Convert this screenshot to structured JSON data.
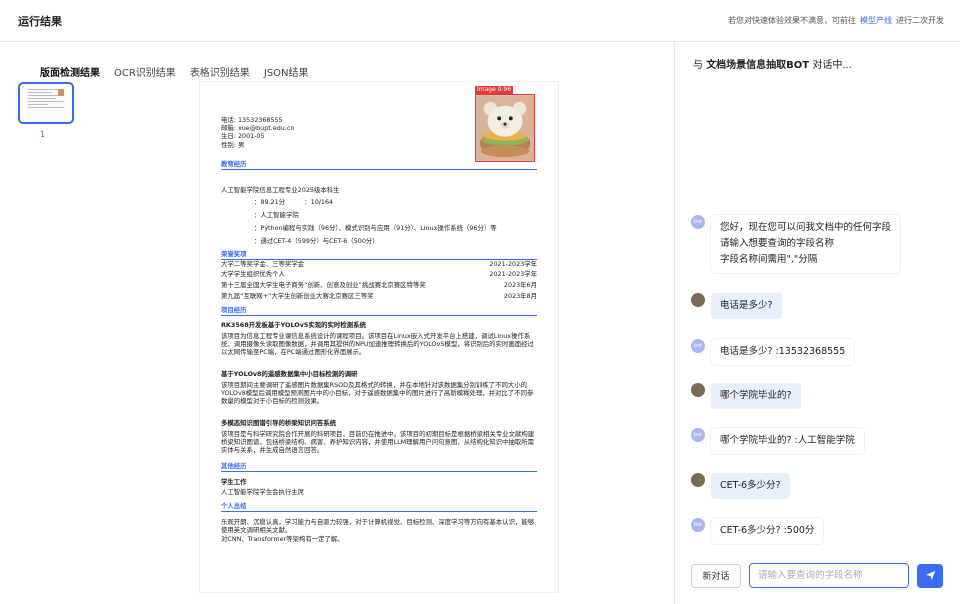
{
  "header": {
    "title": "运行结果",
    "tip_prefix": "若您对快速体验效果不满意，可前往",
    "tip_link": "模型产线",
    "tip_suffix": "进行二次开发"
  },
  "tabs": [
    {
      "label": "版面检测结果"
    },
    {
      "label": "OCR识别结果"
    },
    {
      "label": "表格识别结果"
    },
    {
      "label": "JSON结果"
    }
  ],
  "thumbnail": {
    "page_no": "1"
  },
  "doc": {
    "image_tag": "Image 0.96",
    "contact": [
      "电话: 13532368555",
      "邮箱: xue@bupt.edu.cn",
      "生日: 2001-05",
      "性别: 男"
    ],
    "sec_edu": "教育经历",
    "edu_line": "人工智能学院信息工程专业2025级本科生",
    "edu_details": [
      "：89.21分　　　：10/164",
      "：人工智能学院",
      "：Python编程与实践（96分）、模式识别与应用（91分）、Linux操作系统（96分）等",
      "：通过CET-4（599分）与CET-6（500分）"
    ],
    "sec_honor": "荣誉奖项",
    "honors": [
      {
        "name": "大学二等奖学金、三等奖学金",
        "date": "2021-2023学年"
      },
      {
        "name": "大学学生组织优秀个人",
        "date": "2021-2023学年"
      },
      {
        "name": "第十三届全国大学生电子商务“创新、创意及创业”挑战赛北京赛区特等奖",
        "date": "2023年6月"
      },
      {
        "name": "第九届“互联网+”大学生创新创业大赛北京赛区三等奖",
        "date": "2023年8月"
      }
    ],
    "sec_project": "项目经历",
    "p1_title": "RK3568开发板基于YOLOv5实现的实时检测系统",
    "p1_text": "该项目为信息工程专业课信息系统设计的课程项目。该项目在Linux嵌入式开发平台上搭建，调试Linux操作系统，调用摄像头读取图像数据，并调用其提供的NPU加速推理转换后的YOLOv5模型，将识别后的实时画面经过以太网传输至PC端，在PC端通过图形化界面展示。",
    "p2_title": "基于YOLOv8的遥感数据集中小目标检测的调研",
    "p2_text": "该项目期间主要调研了遥感图片数据集RSOD及其格式的转换，并在本地针对该数据集分别训练了不同大小的YOLOv8模型后调用模型预测图片中的小目标，对于遥感数据集中的图片进行了高斯模糊处理，并对比了不同参数量的模型对于小目标的检测效果。",
    "p3_title": "多模态知识图谱引导的桥梁知识问答系统",
    "p3_text": "该项目是与科学研究院合作开展的科研项目，目前仍在推进中。该项目的初期目标是根据桥梁相关专业文献构建桥梁知识图谱，包括桥梁结构、病害、养护知识内容，并使用LLM理解用户问句意图，从结构化知识中抽取所需实体与关系，并生成自然语言回答。",
    "sec_other": "其他经历",
    "other_title": "学生工作",
    "other_text": "人工智能学院学生会执行主席",
    "sec_summary": "个人总结",
    "summary": [
      "乐观开朗、沉稳认真，学习能力与自驱力较强，对于计算机视觉、目标检测、深度学习等方向有基本认识，能够使用英文调研相关文献。",
      "对CNN、Transformer等架构有一定了解。"
    ]
  },
  "chat": {
    "title_prefix": "与",
    "bot_name": "文档场景信息抽取BOT",
    "title_suffix": "对话中...",
    "bot_avatar": "bot",
    "messages": [
      {
        "role": "bot",
        "text": "您好，现在您可以问我文档中的任何字段\n请输入想要查询的字段名称\n字段名称间需用\",\"分隔"
      },
      {
        "role": "user",
        "text": "电话是多少?"
      },
      {
        "role": "bot",
        "text": "电话是多少? :13532368555"
      },
      {
        "role": "user",
        "text": "哪个学院毕业的?"
      },
      {
        "role": "bot",
        "text": "哪个学院毕业的? :人工智能学院"
      },
      {
        "role": "user",
        "text": "CET-6多少分?"
      },
      {
        "role": "bot",
        "text": "CET-6多少分? :500分"
      }
    ],
    "new_chat": "新对话",
    "input_placeholder": "请输入要查询的字段名称",
    "send_icon": "send-icon"
  },
  "colors": {
    "accent": "#3b6cf6",
    "detect_box": "#e23b3b",
    "user_bubble": "#e7eefc"
  }
}
